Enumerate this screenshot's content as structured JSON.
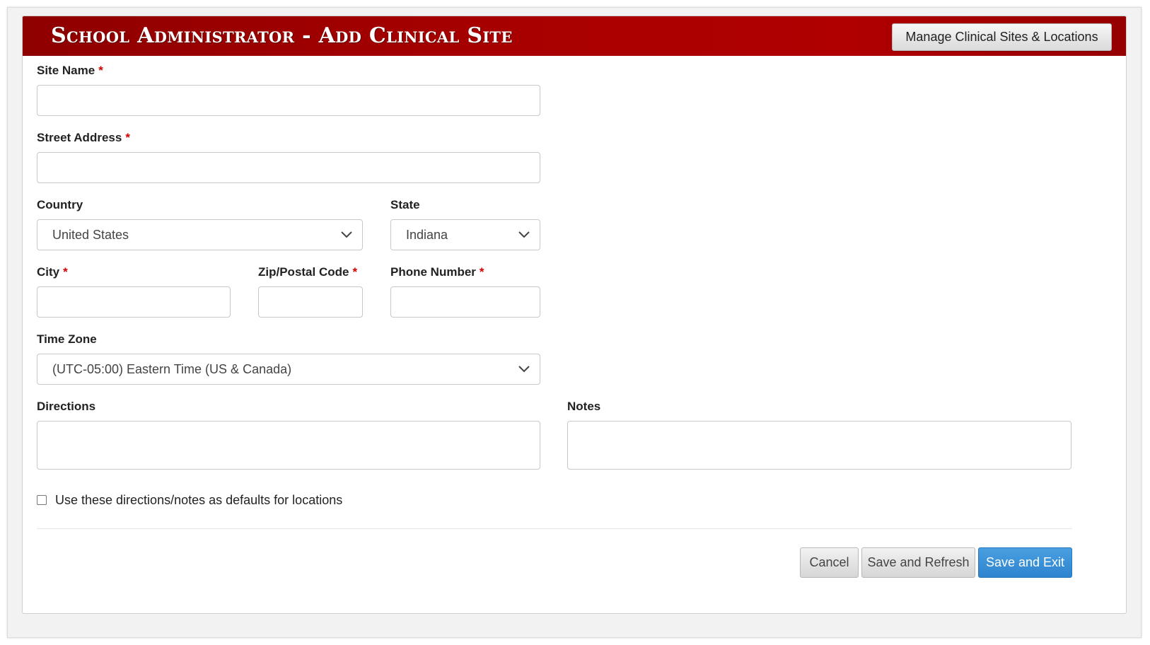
{
  "header": {
    "title": "School Administrator - Add Clinical Site",
    "manage_button_label": "Manage Clinical Sites & Locations"
  },
  "form": {
    "site_name": {
      "label": "Site Name",
      "required_mark": "*",
      "value": ""
    },
    "street_address": {
      "label": "Street Address",
      "required_mark": "*",
      "value": ""
    },
    "country": {
      "label": "Country",
      "selected": "United States"
    },
    "state": {
      "label": "State",
      "selected": "Indiana"
    },
    "city": {
      "label": "City",
      "required_mark": "*",
      "value": ""
    },
    "zip": {
      "label": "Zip/Postal Code",
      "required_mark": "*",
      "value": ""
    },
    "phone": {
      "label": "Phone Number",
      "required_mark": "*",
      "value": ""
    },
    "time_zone": {
      "label": "Time Zone",
      "selected": "(UTC-05:00) Eastern Time (US & Canada)"
    },
    "directions": {
      "label": "Directions",
      "value": ""
    },
    "notes": {
      "label": "Notes",
      "value": ""
    },
    "defaults_checkbox": {
      "label": "Use these directions/notes as defaults for locations",
      "checked": false
    }
  },
  "actions": {
    "cancel_label": "Cancel",
    "save_refresh_label": "Save and Refresh",
    "save_exit_label": "Save and Exit"
  },
  "colors": {
    "header_red": "#a80000",
    "required_red": "#d40000",
    "primary_blue": "#3a8fd6"
  },
  "icons": {
    "dropdown": "chevron-down-icon"
  }
}
